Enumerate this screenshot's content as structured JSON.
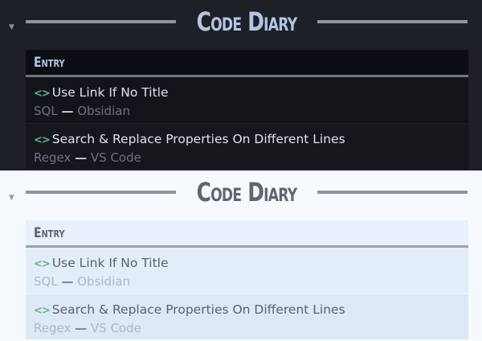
{
  "panels": [
    {
      "theme": "dark",
      "collapse_icon": "▼",
      "heading": "Code Diary",
      "column_header": "Entry",
      "rows": [
        {
          "icon": "<>",
          "title": "Use Link If No Title",
          "language": "SQL",
          "separator": "—",
          "tool": "Obsidian"
        },
        {
          "icon": "<>",
          "title": "Search & Replace Properties On Different Lines",
          "language": "Regex",
          "separator": "—",
          "tool": "VS Code"
        }
      ]
    },
    {
      "theme": "light",
      "collapse_icon": "▼",
      "heading": "Code Diary",
      "column_header": "Entry",
      "rows": [
        {
          "icon": "<>",
          "title": "Use Link If No Title",
          "language": "SQL",
          "separator": "—",
          "tool": "Obsidian"
        },
        {
          "icon": "<>",
          "title": "Search & Replace Properties On Different Lines",
          "language": "Regex",
          "separator": "—",
          "tool": "VS Code"
        }
      ]
    }
  ],
  "colors": {
    "dark_background": "#1e2027",
    "dark_heading": "#b3c6e3",
    "light_background": "#f6faff",
    "light_heading": "#5f6672",
    "code_icon_green": "#59b98c"
  }
}
